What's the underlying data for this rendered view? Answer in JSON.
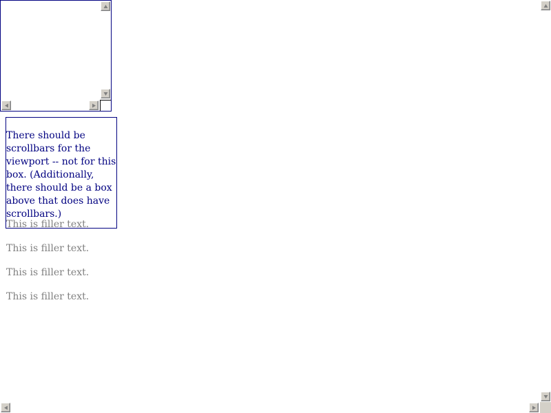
{
  "message": "There should be scrollbars for the viewport -- not for this box. (Additionally, there should be a box above that does have scrollbars.)",
  "filler_lines": [
    "This is filler text.",
    "This is filler text.",
    "This is filler text.",
    "This is filler text."
  ],
  "icons": {
    "up": "arrow-up-icon",
    "down": "arrow-down-icon",
    "left": "arrow-left-icon",
    "right": "arrow-right-icon"
  },
  "colors": {
    "box_border": "#000080",
    "message_text": "#000080",
    "filler_text": "#808080",
    "scrollbar_face": "#d4d0c8"
  }
}
